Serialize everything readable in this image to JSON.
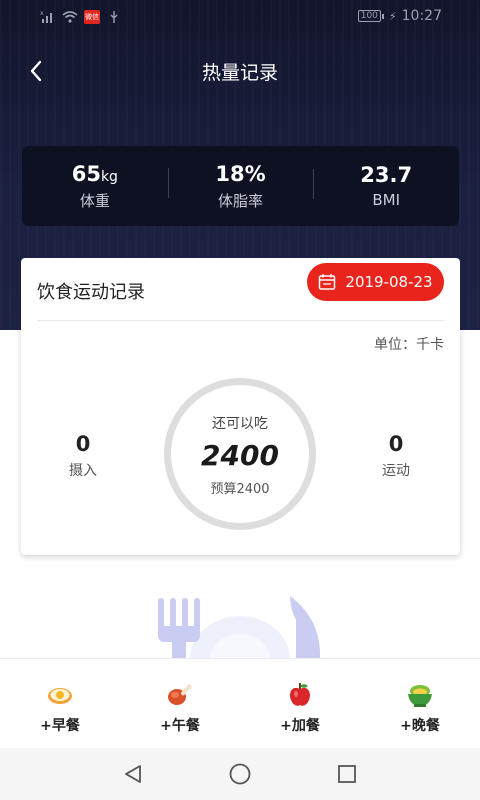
{
  "status_bar": {
    "battery": "100",
    "time": "10:27",
    "badge_text": "微信"
  },
  "header": {
    "title": "热量记录",
    "back_icon": "chevron-left-icon"
  },
  "stats": [
    {
      "value": "65",
      "unit": "kg",
      "label": "体重"
    },
    {
      "value": "18%",
      "unit": "",
      "label": "体脂率"
    },
    {
      "value": "23.7",
      "unit": "",
      "label": "BMI"
    }
  ],
  "record": {
    "title": "饮食运动记录",
    "date": "2019-08-23",
    "unit_label": "单位：千卡",
    "intake": {
      "value": "0",
      "label": "摄入"
    },
    "exercise": {
      "value": "0",
      "label": "运动"
    },
    "ring": {
      "top_label": "还可以吃",
      "value": "2400",
      "budget": "预算2400"
    }
  },
  "meals": [
    {
      "label": "+早餐",
      "icon": "egg-icon"
    },
    {
      "label": "+午餐",
      "icon": "drumstick-icon"
    },
    {
      "label": "+加餐",
      "icon": "apple-icon"
    },
    {
      "label": "+晚餐",
      "icon": "noodle-bowl-icon"
    }
  ],
  "colors": {
    "accent": "#e8241c",
    "hero_bg": "#1b2040",
    "card_dark": "#0e1122"
  }
}
